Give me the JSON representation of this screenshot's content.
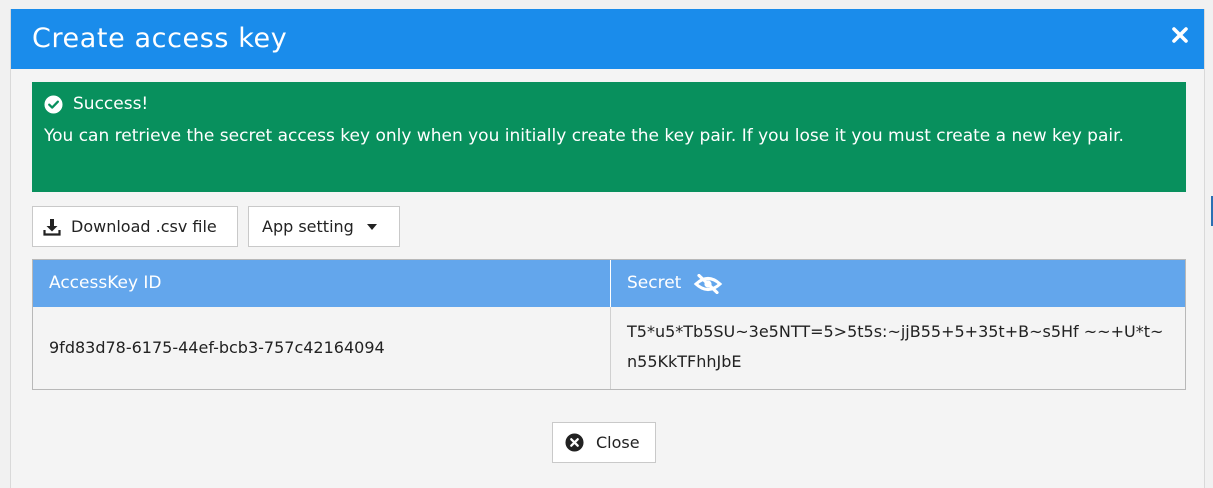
{
  "modal": {
    "title": "Create access key",
    "close_icon": "close-x-icon"
  },
  "alert": {
    "icon": "check-circle-icon",
    "title": "Success!",
    "message": "You can retrieve the secret access key only when you initially create the key pair. If you lose it you must create a new key pair.",
    "background": "#08905d"
  },
  "toolbar": {
    "download_label": "Download .csv file",
    "download_icon": "download-icon",
    "app_setting_label": "App setting",
    "app_setting_icon": "caret-down-icon"
  },
  "table": {
    "headers": {
      "access_key_id": "AccessKey ID",
      "secret": "Secret",
      "secret_icon": "eye-slash-icon"
    },
    "rows": [
      {
        "access_key_id": "9fd83d78-6175-44ef-bcb3-757c42164094",
        "secret": "T5*u5*Tb5SU~3e5NTT=5>5t5s:~jjB55+5+35t+B~s5Hf ~~+U*t~n55KkTFhhJbE"
      }
    ]
  },
  "footer": {
    "close_label": "Close",
    "close_icon": "times-circle-icon"
  },
  "colors": {
    "header": "#1a8ceb",
    "table_header": "#63a6ec",
    "success": "#08905d"
  }
}
